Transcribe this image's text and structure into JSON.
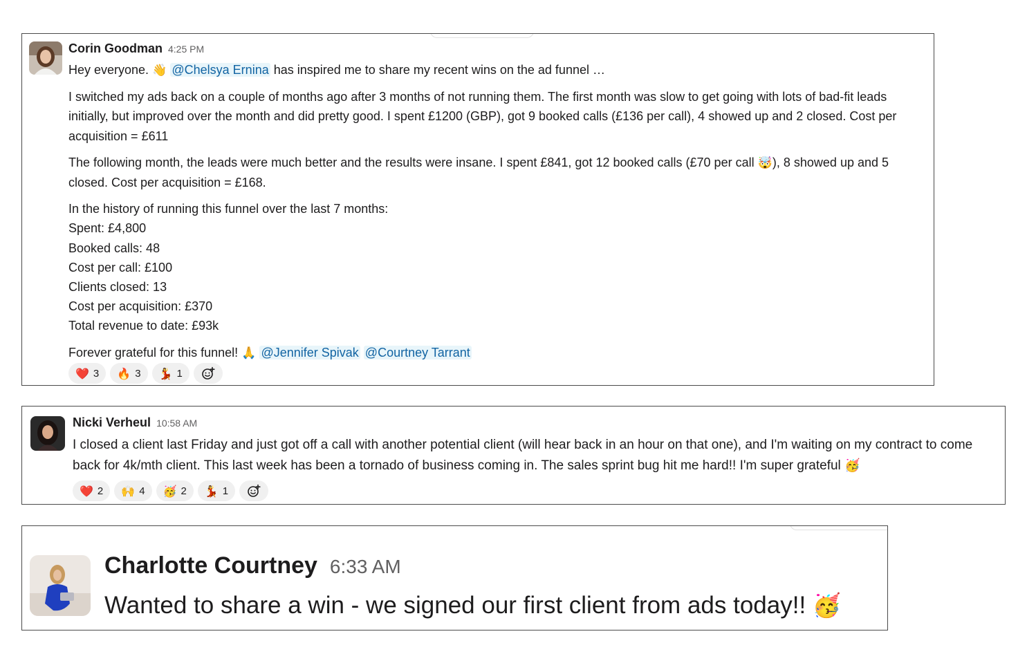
{
  "messages": [
    {
      "author": "Corin Goodman",
      "time": "4:25 PM",
      "line1": {
        "before": "Hey everyone. ",
        "emoji": "👋",
        "mention": "@Chelsya Ernina",
        "after": " has inspired me to share my recent wins on the ad funnel …"
      },
      "para1": "I switched my ads back on a couple of months ago after 3 months of not running them. The first month was slow to get going with lots of bad-fit leads initially, but improved over the month and did pretty good. I spent £1200 (GBP), got 9 booked calls (£136 per call), 4 showed up and 2 closed. Cost per acquisition = £611",
      "para2": {
        "before": "The following month, the leads were much better and the results were insane. I spent £841, got 12 booked calls (£70 per call ",
        "emoji": "🤯",
        "after": "), 8 showed up and 5 closed. Cost per acquisition = £168."
      },
      "history": [
        "In the history of running this funnel over the last 7 months:",
        "Spent: £4,800",
        "Booked calls: 48",
        "Cost per call: £100",
        "Clients closed: 13",
        "Cost per acquisition: £370",
        "Total revenue to date: £93k"
      ],
      "closing": {
        "text": "Forever grateful for this funnel! ",
        "emoji": "🙏",
        "mention1": "@Jennifer Spivak",
        "mention2": "@Courtney Tarrant"
      },
      "reactions": [
        {
          "emoji": "❤️",
          "count": "3"
        },
        {
          "emoji": "🔥",
          "count": "3"
        },
        {
          "emoji": "💃",
          "count": "1"
        }
      ]
    },
    {
      "author": "Nicki Verheul",
      "time": "10:58 AM",
      "text": "I closed a client last Friday and just got off a call with another potential client (will hear back in an hour on that one), and I'm waiting on my contract to come back for 4k/mth client. This last week has been a tornado of business coming in. The sales sprint bug hit me hard!! I'm super grateful ",
      "emoji": "🥳",
      "reactions": [
        {
          "emoji": "❤️",
          "count": "2"
        },
        {
          "emoji": "🙌",
          "count": "4"
        },
        {
          "emoji": "🥳",
          "count": "2"
        },
        {
          "emoji": "💃",
          "count": "1"
        }
      ]
    },
    {
      "author": "Charlotte Courtney",
      "time": "6:33 AM",
      "text": "Wanted to share a win - we signed our first client from ads today!! ",
      "emoji": "🥳"
    }
  ],
  "icons": {
    "add_reaction": "add-reaction-icon"
  }
}
